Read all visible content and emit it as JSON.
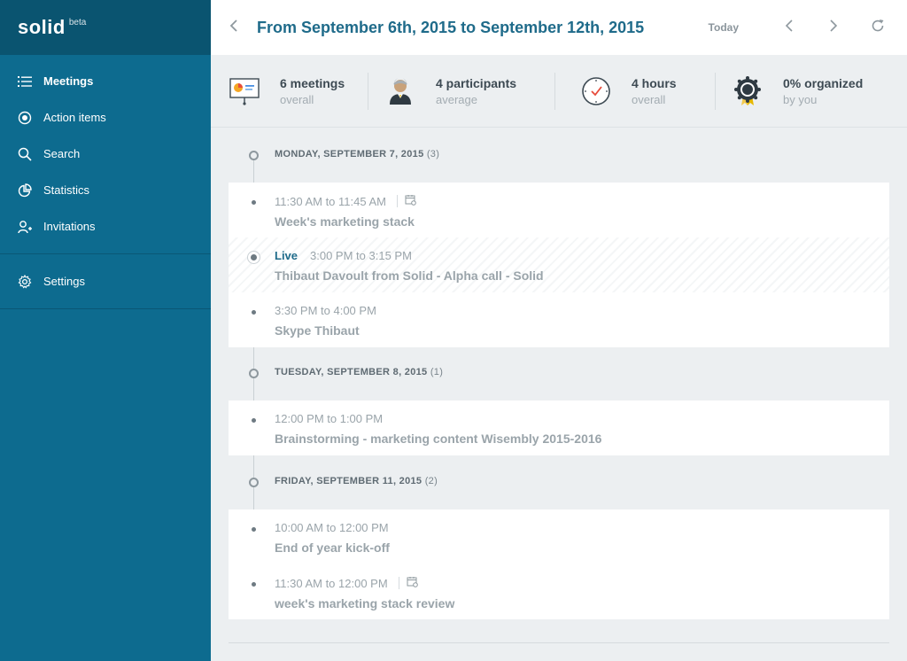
{
  "brand": {
    "logo": "solid",
    "tag": "beta"
  },
  "sidebar": {
    "items": [
      {
        "label": "Meetings",
        "icon": "list-icon",
        "active": true
      },
      {
        "label": "Action items",
        "icon": "target-icon"
      },
      {
        "label": "Search",
        "icon": "search-icon"
      },
      {
        "label": "Statistics",
        "icon": "pie-chart-icon"
      },
      {
        "label": "Invitations",
        "icon": "add-user-icon"
      }
    ],
    "settings_label": "Settings"
  },
  "header": {
    "title": "From September 6th, 2015 to September 12th, 2015",
    "today_label": "Today"
  },
  "stats": [
    {
      "main": "6 meetings",
      "sub": "overall",
      "icon": "presentation-icon"
    },
    {
      "main": "4 participants",
      "sub": "average",
      "icon": "person-icon"
    },
    {
      "main": "4 hours",
      "sub": "overall",
      "icon": "clock-icon"
    },
    {
      "main": "0% organized",
      "sub": "by you",
      "icon": "badge-icon"
    }
  ],
  "days": [
    {
      "label": "MONDAY, SEPTEMBER 7, 2015",
      "count": "(3)",
      "meetings": [
        {
          "time": "11:30 AM to 11:45 AM",
          "title": "Week's marketing stack",
          "calendar": true
        },
        {
          "live": "Live",
          "time": "3:00 PM to 3:15 PM",
          "title": "Thibaut Davoult from Solid - Alpha call - Solid"
        },
        {
          "time": "3:30 PM to 4:00 PM",
          "title": "Skype Thibaut"
        }
      ]
    },
    {
      "label": "TUESDAY, SEPTEMBER 8, 2015",
      "count": "(1)",
      "meetings": [
        {
          "time": "12:00 PM to 1:00 PM",
          "title": "Brainstorming - marketing content Wisembly 2015-2016"
        }
      ]
    },
    {
      "label": "FRIDAY, SEPTEMBER 11, 2015",
      "count": "(2)",
      "meetings": [
        {
          "time": "10:00 AM to 12:00 PM",
          "title": "End of year kick-off"
        },
        {
          "time": "11:30 AM to 12:00 PM",
          "title": "week's marketing stack review",
          "calendar": true
        }
      ]
    }
  ],
  "colors": {
    "sidebar": "#0d6b8f",
    "brand_bar": "#0a5470",
    "accent": "#1f6b8a",
    "background": "#eceff1"
  }
}
